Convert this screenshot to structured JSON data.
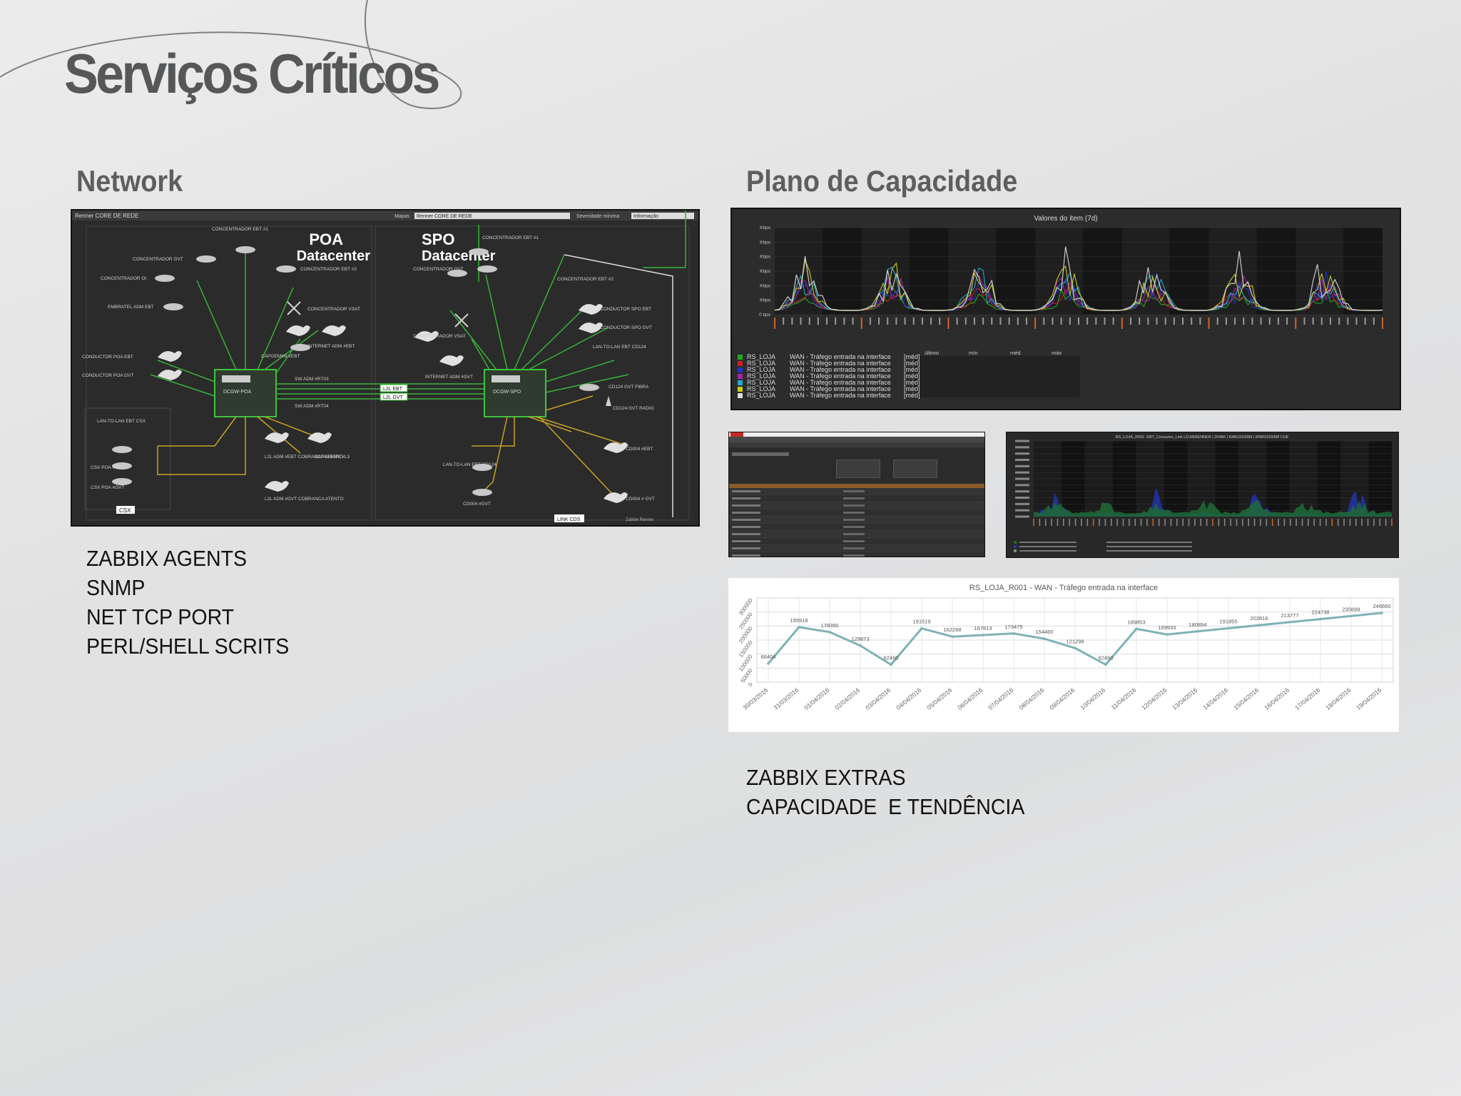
{
  "slide": {
    "title": "Serviços Críticos"
  },
  "left": {
    "heading": "Network",
    "map": {
      "name": "Renner CORE DE REDE",
      "filter_label": "Mapas",
      "filter_value": "Renner CORE DE REDE",
      "severity_label": "Severidade mínima",
      "severity_value": "Informação",
      "poa_title": "POA",
      "poa_subtitle": "Datacenter",
      "spo_title": "SPO",
      "spo_subtitle": "Datacenter",
      "link_labels": [
        "L2L EBT",
        "L2L GVT"
      ],
      "node_labels": {
        "poa_ebt1": "CONCENTRADOR EBT #1",
        "poa_gvt": "CONCENTRADOR GVT",
        "poa_oi": "CONCENTRADOR OI",
        "poa_embratel": "EMBRATEL ADM EBT",
        "poa_ebt2": "CONCENTRADOR EBT #2",
        "poa_vsat": "CONCENTRADOR VSAT",
        "poa_internet": "INTERNET ADM #EBT",
        "poa_cap": "CAPGEMINI #EBT",
        "poa_sw1": "SW ADM #RT03",
        "poa_sw2": "SW ADM #RT04",
        "poa_cond_ebt": "CONDUCTOR POA EBT",
        "poa_cond_gvt": "CONDUCTOR POA GVT",
        "poa_lan": "LAN-TO-LAN EBT CSX",
        "poa_csx_ebt": "CSX POA #EBT",
        "poa_csx_gvt": "CSX POA #GVT",
        "poa_l2l_ebt": "L2L ADM #EBT COBRANCA ATENTO",
        "poa_l2l_gvt": "L2L ADM #GVT COBRANCA ATENTO",
        "poa_cap_l3": "CAPGEMINI #L3",
        "poa_core": "DCGW-POA",
        "spo_ebt1": "CONCENTRADOR EBT #1",
        "spo_gvt": "CONCENTRADOR GVT",
        "spo_ebt2": "CONCENTRADOR EBT #2",
        "spo_vsat": "CONCENTRADOR VSAT",
        "spo_internet": "INTERNET ADM #GVT",
        "spo_cond_ebt": "CONDUCTOR SPO EBT",
        "spo_cond_gvt": "CONDUCTOR SPO GVT",
        "spo_lan": "LAN-TO-LAN EBT CD124",
        "spo_cd124_gvt": "CD124 GVT FIBRA",
        "spo_cd124_radio": "CD124 GVT RADIO",
        "spo_cd004_ebt": "CD004 #EBT",
        "spo_cd004_gvt": "CD004 # GVT",
        "spo_lan2": "LAN-TO-LAN EBT CD124",
        "spo_cd004": "CD004 #GVT",
        "spo_core": "DCGW-SPO"
      },
      "badge_left": "CSX",
      "badge_right": "LINK CDS",
      "footer": "Zabbix Renner"
    },
    "items": [
      "ZABBIX AGENTS",
      "SNMP",
      "NET TCP PORT",
      "PERL/SHELL SCRITS"
    ]
  },
  "right": {
    "heading": "Plano de Capacidade",
    "traffic_chart": {
      "title": "Valores do item (7d)",
      "y_ticks": [
        "0 bps",
        "Kbps",
        "Kbps",
        "Kbps",
        "Kbps",
        "Kbps",
        "Kbps"
      ],
      "table_headers": [
        "último",
        "mín",
        "méd",
        "máx"
      ],
      "legend": [
        {
          "host": "RS_LOJA",
          "item": "WAN - Tráfego entrada na interface",
          "func": "[méd]",
          "color": "#22aa22"
        },
        {
          "host": "RS_LOJA",
          "item": "WAN - Tráfego entrada na interface",
          "func": "[méd]",
          "color": "#cc2222"
        },
        {
          "host": "RS_LOJA",
          "item": "WAN - Tráfego entrada na interface",
          "func": "[méd]",
          "color": "#2233cc"
        },
        {
          "host": "RS_LOJA",
          "item": "WAN - Tráfego entrada na interface",
          "func": "[méd]",
          "color": "#aa22aa"
        },
        {
          "host": "RS_LOJA",
          "item": "WAN - Tráfego entrada na interface",
          "func": "[méd]",
          "color": "#22aacc"
        },
        {
          "host": "RS_LOJA",
          "item": "WAN - Tráfego entrada na interface",
          "func": "[méd]",
          "color": "#cccc22"
        },
        {
          "host": "RS_LOJA",
          "item": "WAN - Tráfego entrada na interface",
          "func": "[méd]",
          "color": "#dddddd"
        }
      ],
      "colors": [
        "#22aa22",
        "#cc2222",
        "#2233cc",
        "#aa22aa",
        "#22aacc",
        "#cccc22",
        "#dddddd"
      ]
    },
    "history_table": {
      "rows": 22
    },
    "wan_chart": {
      "title": "RS_LOJA_R001: EBT_Consumo_Link LOJA|RENNER | 2048K | RAB1915088 | IPAB1915088 CUE"
    },
    "trend_chart": {
      "title": "RS_LOJA_R001 - WAN - Tráfego entrada na interface",
      "chart_data": {
        "type": "line",
        "title": "RS_LOJA_R001 - WAN - Tráfego entrada na interface",
        "xlabel": "",
        "ylabel": "",
        "ylim": [
          0,
          300000
        ],
        "y_ticks": [
          0,
          50000,
          100000,
          150000,
          200000,
          250000,
          300000
        ],
        "grid": true,
        "x": [
          "30/03/2016",
          "31/03/2016",
          "01/04/2016",
          "02/04/2016",
          "03/04/2016",
          "04/04/2016",
          "05/04/2016",
          "06/04/2016",
          "07/04/2016",
          "08/04/2016",
          "09/04/2016",
          "10/04/2016",
          "11/04/2016",
          "12/04/2016",
          "13/04/2016",
          "14/04/2016",
          "15/04/2016",
          "16/04/2016",
          "17/04/2016",
          "18/04/2016",
          "19/04/2016"
        ],
        "values": [
          66404,
          195918,
          178390,
          129873,
          62460,
          191519,
          162298,
          167813,
          173475,
          154460,
          121298,
          62460,
          189853,
          169933,
          180894,
          191855,
          202816,
          213777,
          224738,
          235699,
          246660
        ],
        "series_color": "#7fb2b5"
      }
    },
    "items": [
      "ZABBIX EXTRAS",
      "CAPACIDADE  E TENDÊNCIA"
    ]
  }
}
